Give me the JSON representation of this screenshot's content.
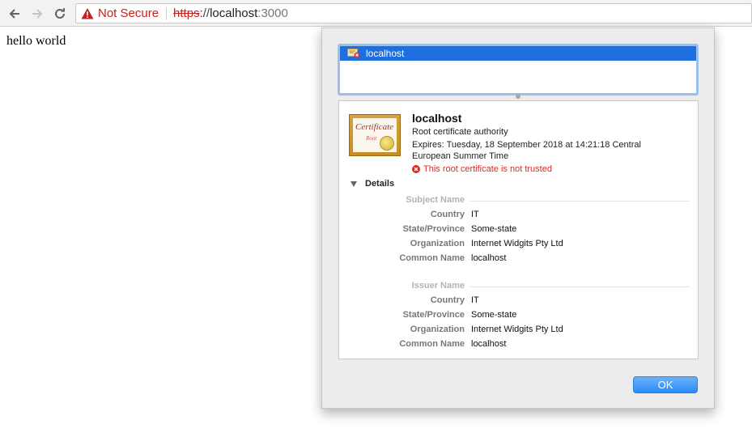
{
  "browser": {
    "security_label": "Not Secure",
    "url_scheme": "https",
    "url_sep": "://",
    "url_host": "localhost",
    "url_port": ":3000"
  },
  "page": {
    "body_text": "hello world"
  },
  "dialog": {
    "list_item": "localhost",
    "cert": {
      "image_word": "Certificate",
      "image_sub": "Root",
      "name": "localhost",
      "type": "Root certificate authority",
      "expires": "Expires: Tuesday, 18 September 2018 at 14:21:18 Central European Summer Time",
      "error": "This root certificate is not trusted"
    },
    "details_label": "Details",
    "subject": {
      "heading": "Subject Name",
      "country_label": "Country",
      "country": "IT",
      "state_label": "State/Province",
      "state": "Some-state",
      "org_label": "Organization",
      "org": "Internet Widgits Pty Ltd",
      "cn_label": "Common Name",
      "cn": "localhost"
    },
    "issuer": {
      "heading": "Issuer Name",
      "country_label": "Country",
      "country": "IT",
      "state_label": "State/Province",
      "state": "Some-state",
      "org_label": "Organization",
      "org": "Internet Widgits Pty Ltd",
      "cn_label": "Common Name",
      "cn": "localhost"
    },
    "ok_label": "OK"
  },
  "icons": {
    "back": "back-arrow-icon",
    "forward": "forward-arrow-icon",
    "reload": "reload-icon",
    "warning": "warning-triangle-icon",
    "certificate": "certificate-icon",
    "error": "error-circle-icon"
  },
  "colors": {
    "danger": "#c5221f",
    "selection": "#1f6fe0",
    "button": "#2a8af6"
  }
}
